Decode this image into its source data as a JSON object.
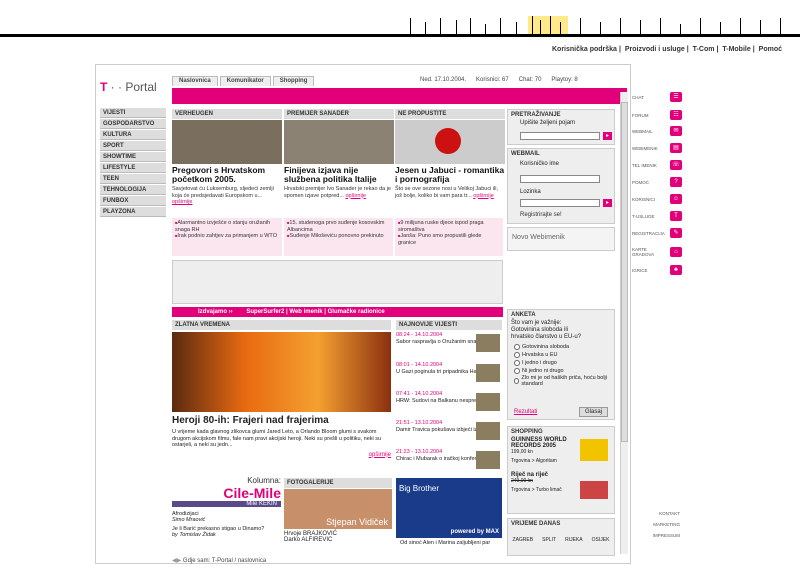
{
  "top_links": [
    "Korisnička podrška",
    "Proizvodi i usluge",
    "T-Com",
    "T-Mobile",
    "Pomoć"
  ],
  "logo": {
    "prefix": "T",
    "suffix": "Portal"
  },
  "tabs": [
    "Naslovnica",
    "Komunikator",
    "Shopping"
  ],
  "stats": {
    "date": "Ned. 17.10.2004.",
    "users": "Korisnici: 67",
    "chat": "Chat: 70",
    "playtoy": "Playtoy: 8"
  },
  "left_nav": [
    "VIJESTI",
    "GOSPODARSTVO",
    "KULTURA",
    "SPORT",
    "SHOWTIME",
    "LIFESTYLE",
    "TEEN",
    "TEHNOLOGIJA",
    "FUNBOX",
    "PLAYZONA"
  ],
  "news": [
    {
      "head": "VERHEUGEN",
      "title": "Pregovori s Hrvatskom početkom 2005.",
      "text": "Savjetovat ću Luksemburg, sljedeći zemlji koja će predsjedavati Europskom u...",
      "more": "opširnije",
      "color": "#6b6356"
    },
    {
      "head": "PREMIJER SANADER",
      "title": "Finijeva izjava nije službena politika Italije",
      "text": "Hrvatski premijer Ivo Sanader je rekao da je spomen izjave potpred...",
      "more": "opširnije",
      "color": "#7d7466"
    },
    {
      "head": "NE PROPUSTITE",
      "title": "Jesen u Jabuci - romantika i pornografija",
      "text": "Što se ove sezone nosi u Velikoj Jabuci ili, još bolje, koliko bi vam para tr...",
      "more": "opširnije",
      "color": "#b22"
    }
  ],
  "pink_lists": [
    [
      "Alarmantno izvješće o stanju oružanih snaga RH",
      "Irak podnio zahtjev za primanjem u WTO"
    ],
    [
      "15. studenoga prvo suđenje kosovskim Albancima",
      "Suđenje Miloševiću ponovno prekinuto"
    ],
    [
      "9 milijuna ruske djece ispod praga siromaštva",
      "Janša: Puno smo propustili glede granice"
    ]
  ],
  "search": {
    "title": "PRETRAŽIVANJE",
    "label": "Upišite željeni pojam"
  },
  "webmail": {
    "title": "WEBMAIL",
    "user_label": "Korisničko ime",
    "pass_label": "Lozinka",
    "register": "Registrirajte se!",
    "imenik": "Novo Webimenik"
  },
  "promo": {
    "label": "Izdvajamo",
    "links": "SuperSurfer2 | Web imenik | Glumačke radionice"
  },
  "zlatna": {
    "head": "ZLATNA VREMENA",
    "title": "Heroji 80-ih: Frajeri nad frajerima",
    "text": "U vrijeme kada glavnog zlikovca glumi Jared Leto, a Orlando Bloom glumi s svakom drugom akcijskom filmu, fale nam pravi akcijski heroji. Neki su prešli u politiku, neki su ostarjeli, a neki su jedn...",
    "more": "opširnije"
  },
  "latest": {
    "head": "NAJNOVIJE VIJESTI",
    "items": [
      {
        "time": "08:24 - 14.10.2004",
        "text": "Sabor raspravlja o Oružanim snagama"
      },
      {
        "time": "08:01 - 14.10.2004",
        "text": "U Gazi poginula tri pripadnika Hamasa"
      },
      {
        "time": "07:41 - 14.10.2004",
        "text": "HRW: Sudovi na Balkanu nespremni"
      },
      {
        "time": "21:51 - 13.10.2004",
        "text": "Damir Travica pokušava izbjeći izručenje"
      },
      {
        "time": "21:23 - 13.10.2004",
        "text": "Chirac i Mubarak o iračkoj konferenciji"
      }
    ]
  },
  "anketa": {
    "title": "ANKETA",
    "question": "Što vam je važnije: Gotovinina sloboda ili hrvatsko članstvo u EU-u?",
    "options": [
      "Gotovinina sloboda",
      "Hrvatska u EU",
      "I jedno i drugo",
      "Ni jedno ni drugo",
      "Zlo mi je od haških priča, hoću bolji standard"
    ],
    "results": "Rezultati",
    "vote": "Glasaj"
  },
  "shopping": {
    "title": "SHOPPING",
    "item1": "GUINNESS WORLD RECORDS 2005",
    "price1": "199,00 kn",
    "store1": "Trgovina > Algoritam",
    "item2": "Riječ na riječ",
    "oldprice2": "249,00 kn",
    "store2": "Trgovina > Turbo limač"
  },
  "weather": {
    "title": "VRIJEME DANAS",
    "cities": [
      "ZAGREB",
      "SPLIT",
      "RIJEKA",
      "OSIJEK"
    ]
  },
  "kolumna": {
    "label": "Kolumna:",
    "name": "Cile-Mile",
    "sub": "Mile KEKIN",
    "l1": "Afrodizijaci",
    "l2": "Simo Mraović",
    "l3": "Je li Barić prekasno stigao u Dinamo?",
    "l4": "by Tomislav Židak"
  },
  "foto": {
    "head": "FOTOGALERIJE",
    "caption": "Stjepan Vidiček",
    "items": [
      "Hrvoje BRAJKOVIĆ",
      "Darko ALFIREVIC"
    ]
  },
  "bigbrother": {
    "logo": "Big Brother",
    "powered": "powered by MAX",
    "text": "Od sinoć Alen i Marina zaljubljeni par"
  },
  "right_icons": [
    "CHAT",
    "FORUM",
    "WEBMAIL",
    "WEBIMENIK",
    "TEL IMENIK",
    "POMOĆ",
    "KORISNICI",
    "T-USLUGE",
    "REGISTRACIJA",
    "KARTE GRADOVA",
    "IGRICE"
  ],
  "right_footer": [
    "KONTAKT",
    "MARKETING",
    "IMPRESSUM"
  ],
  "status": "Gdje sam: T-Portal / naslovnica"
}
